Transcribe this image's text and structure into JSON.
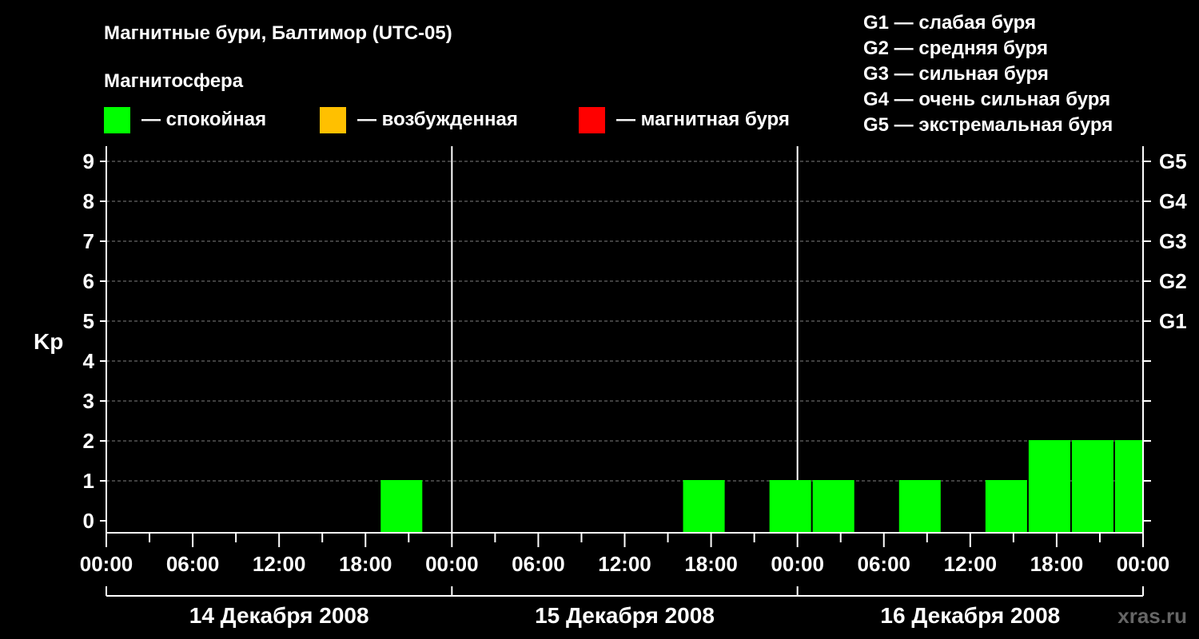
{
  "title": "Магнитные бури, Балтимор (UTC-05)",
  "legend": {
    "heading": "Магнитосфера",
    "items": [
      {
        "label": "— спокойная",
        "color": "#00ff00"
      },
      {
        "label": "— возбужденная",
        "color": "#ffc000"
      },
      {
        "label": "— магнитная буря",
        "color": "#ff0000"
      }
    ]
  },
  "storm_scale": [
    "G1 — слабая буря",
    "G2 — средняя буря",
    "G3 — сильная буря",
    "G4 — очень сильная буря",
    "G5 — экстремальная буря"
  ],
  "watermark": "xras.ru",
  "chart_data": {
    "type": "bar",
    "ylabel": "Kp",
    "ylim": [
      0,
      9
    ],
    "yticks": [
      "0",
      "1",
      "2",
      "3",
      "4",
      "5",
      "6",
      "7",
      "8",
      "9"
    ],
    "right_ticks": [
      {
        "label": "G1",
        "kp": 5
      },
      {
        "label": "G2",
        "kp": 6
      },
      {
        "label": "G3",
        "kp": 7
      },
      {
        "label": "G4",
        "kp": 8
      },
      {
        "label": "G5",
        "kp": 9
      }
    ],
    "xticks": [
      "00:00",
      "06:00",
      "12:00",
      "18:00",
      "00:00",
      "06:00",
      "12:00",
      "18:00",
      "00:00",
      "06:00",
      "12:00",
      "18:00",
      "00:00"
    ],
    "days": [
      "14 Декабря 2008",
      "15 Декабря 2008",
      "16 Декабря 2008"
    ],
    "grid": true,
    "bar_color": "#00ff00",
    "bars": [
      {
        "start_hour": 19,
        "end_hour": 22,
        "kp": 1
      },
      {
        "start_hour": 40,
        "end_hour": 43,
        "kp": 1
      },
      {
        "start_hour": 46,
        "end_hour": 49,
        "kp": 1
      },
      {
        "start_hour": 49,
        "end_hour": 52,
        "kp": 1
      },
      {
        "start_hour": 55,
        "end_hour": 58,
        "kp": 1
      },
      {
        "start_hour": 61,
        "end_hour": 64,
        "kp": 1
      },
      {
        "start_hour": 64,
        "end_hour": 67,
        "kp": 2
      },
      {
        "start_hour": 67,
        "end_hour": 70,
        "kp": 2
      },
      {
        "start_hour": 70,
        "end_hour": 72,
        "kp": 2
      }
    ]
  }
}
